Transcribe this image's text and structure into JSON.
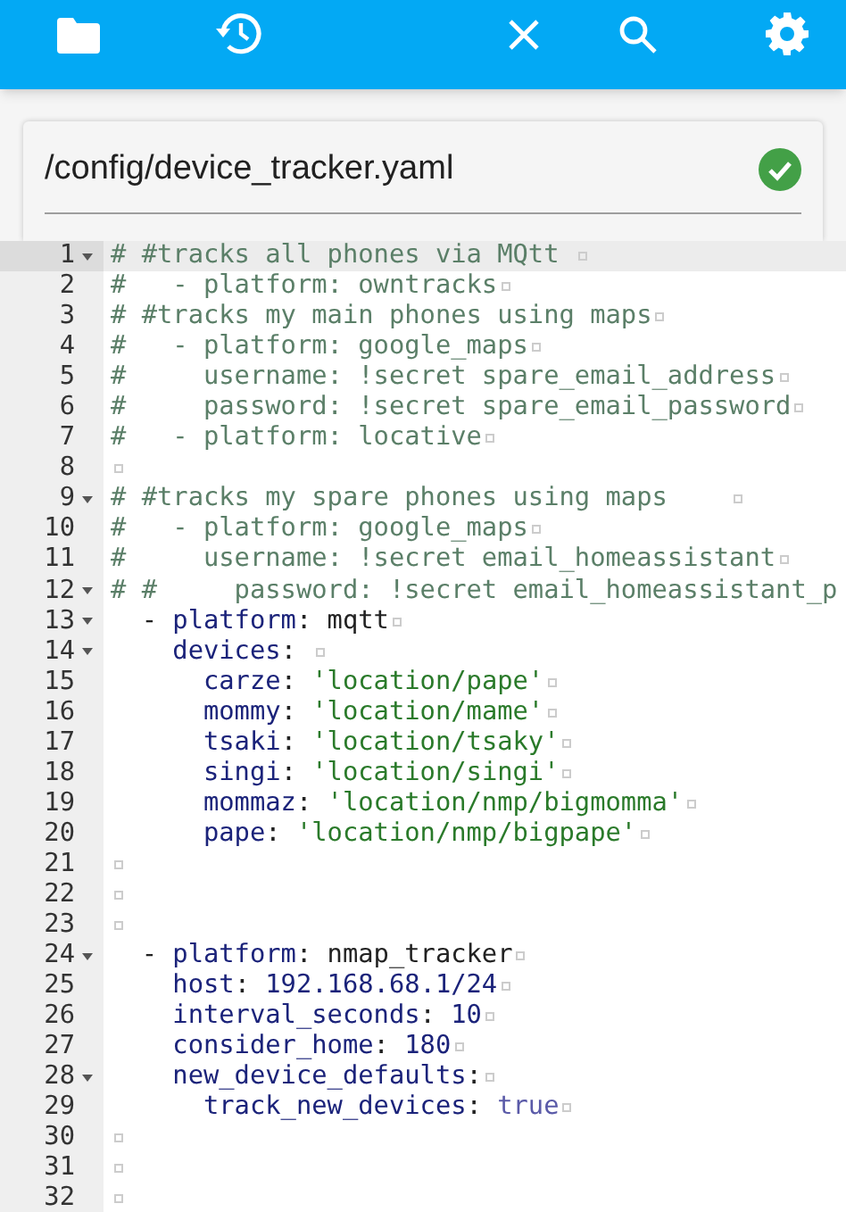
{
  "file": {
    "path": "/config/device_tracker.yaml",
    "valid": true
  },
  "editor": {
    "lines": [
      {
        "number": "1",
        "fold": true,
        "active": true,
        "tokens": [
          {
            "kind": "comment",
            "text": "# #tracks all phones via MQtt "
          }
        ]
      },
      {
        "number": "2",
        "fold": false,
        "active": false,
        "tokens": [
          {
            "kind": "comment",
            "text": "#   - platform: owntracks"
          }
        ]
      },
      {
        "number": "3",
        "fold": false,
        "active": false,
        "tokens": [
          {
            "kind": "comment",
            "text": "# #tracks my main phones using maps"
          }
        ]
      },
      {
        "number": "4",
        "fold": false,
        "active": false,
        "tokens": [
          {
            "kind": "comment",
            "text": "#   - platform: google_maps"
          }
        ]
      },
      {
        "number": "5",
        "fold": false,
        "active": false,
        "tokens": [
          {
            "kind": "comment",
            "text": "#     username: !secret spare_email_address"
          }
        ]
      },
      {
        "number": "6",
        "fold": false,
        "active": false,
        "tokens": [
          {
            "kind": "comment",
            "text": "#     password: !secret spare_email_password"
          }
        ]
      },
      {
        "number": "7",
        "fold": false,
        "active": false,
        "tokens": [
          {
            "kind": "comment",
            "text": "#   - platform: locative"
          }
        ]
      },
      {
        "number": "8",
        "fold": false,
        "active": false
      },
      {
        "number": "9",
        "fold": true,
        "active": false,
        "tokens": [
          {
            "kind": "comment",
            "text": "# #tracks my spare phones using maps    "
          }
        ]
      },
      {
        "number": "10",
        "fold": false,
        "active": false,
        "tokens": [
          {
            "kind": "comment",
            "text": "#   - platform: google_maps"
          }
        ]
      },
      {
        "number": "11",
        "fold": false,
        "active": false,
        "tokens": [
          {
            "kind": "comment",
            "text": "#     username: !secret email_homeassistant"
          }
        ]
      },
      {
        "number": "12",
        "fold": true,
        "active": false,
        "cut": true,
        "tokens": [
          {
            "kind": "comment",
            "text": "# #     password: !secret email_homeassistant_p"
          }
        ]
      },
      {
        "number": "13",
        "fold": true,
        "active": false,
        "tokens": [
          {
            "kind": "plain",
            "text": "  - "
          },
          {
            "kind": "key",
            "text": "platform"
          },
          {
            "kind": "plain",
            "text": ": mqtt"
          }
        ]
      },
      {
        "number": "14",
        "fold": true,
        "active": false,
        "tokens": [
          {
            "kind": "key",
            "text": "    devices"
          },
          {
            "kind": "plain",
            "text": ": "
          }
        ]
      },
      {
        "number": "15",
        "fold": false,
        "active": false,
        "tokens": [
          {
            "kind": "key",
            "text": "      carze"
          },
          {
            "kind": "plain",
            "text": ": "
          },
          {
            "kind": "string",
            "text": "'location/pape'"
          }
        ]
      },
      {
        "number": "16",
        "fold": false,
        "active": false,
        "tokens": [
          {
            "kind": "key",
            "text": "      mommy"
          },
          {
            "kind": "plain",
            "text": ": "
          },
          {
            "kind": "string",
            "text": "'location/mame'"
          }
        ]
      },
      {
        "number": "17",
        "fold": false,
        "active": false,
        "tokens": [
          {
            "kind": "key",
            "text": "      tsaki"
          },
          {
            "kind": "plain",
            "text": ": "
          },
          {
            "kind": "string",
            "text": "'location/tsaky'"
          }
        ]
      },
      {
        "number": "18",
        "fold": false,
        "active": false,
        "tokens": [
          {
            "kind": "key",
            "text": "      singi"
          },
          {
            "kind": "plain",
            "text": ": "
          },
          {
            "kind": "string",
            "text": "'location/singi'"
          }
        ]
      },
      {
        "number": "19",
        "fold": false,
        "active": false,
        "tokens": [
          {
            "kind": "key",
            "text": "      mommaz"
          },
          {
            "kind": "plain",
            "text": ": "
          },
          {
            "kind": "string",
            "text": "'location/nmp/bigmomma'"
          }
        ]
      },
      {
        "number": "20",
        "fold": false,
        "active": false,
        "tokens": [
          {
            "kind": "key",
            "text": "      pape"
          },
          {
            "kind": "plain",
            "text": ": "
          },
          {
            "kind": "string",
            "text": "'location/nmp/bigpape'"
          }
        ]
      },
      {
        "number": "21",
        "fold": false,
        "active": false
      },
      {
        "number": "22",
        "fold": false,
        "active": false
      },
      {
        "number": "23",
        "fold": false,
        "active": false
      },
      {
        "number": "24",
        "fold": true,
        "active": false,
        "tokens": [
          {
            "kind": "plain",
            "text": "  - "
          },
          {
            "kind": "key",
            "text": "platform"
          },
          {
            "kind": "plain",
            "text": ": nmap_tracker"
          }
        ]
      },
      {
        "number": "25",
        "fold": false,
        "active": false,
        "tokens": [
          {
            "kind": "key",
            "text": "    host"
          },
          {
            "kind": "plain",
            "text": ": "
          },
          {
            "kind": "number",
            "text": "192.168.68.1/24"
          }
        ]
      },
      {
        "number": "26",
        "fold": false,
        "active": false,
        "tokens": [
          {
            "kind": "key",
            "text": "    interval_seconds"
          },
          {
            "kind": "plain",
            "text": ": "
          },
          {
            "kind": "number",
            "text": "10"
          }
        ]
      },
      {
        "number": "27",
        "fold": false,
        "active": false,
        "tokens": [
          {
            "kind": "key",
            "text": "    consider_home"
          },
          {
            "kind": "plain",
            "text": ": "
          },
          {
            "kind": "number",
            "text": "180"
          }
        ]
      },
      {
        "number": "28",
        "fold": true,
        "active": false,
        "tokens": [
          {
            "kind": "key",
            "text": "    new_device_defaults"
          },
          {
            "kind": "plain",
            "text": ":"
          }
        ]
      },
      {
        "number": "29",
        "fold": false,
        "active": false,
        "tokens": [
          {
            "kind": "key",
            "text": "      track_new_devices"
          },
          {
            "kind": "plain",
            "text": ": "
          },
          {
            "kind": "bool",
            "text": "true"
          }
        ]
      },
      {
        "number": "30",
        "fold": false,
        "active": false
      },
      {
        "number": "31",
        "fold": false,
        "active": false
      },
      {
        "number": "32",
        "fold": false,
        "active": false
      }
    ]
  }
}
